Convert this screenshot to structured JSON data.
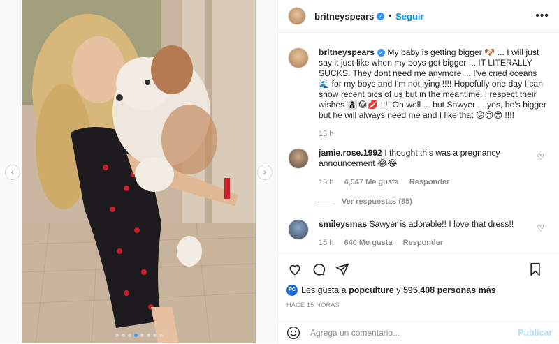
{
  "post": {
    "username": "britneyspears",
    "follow_label": "Seguir",
    "more_label": "•••",
    "caption": "My baby is getting bigger 🐶 ... I will just say it just like when my boys got bigger ... IT LITERALLY SUCKS. They dont need me anymore ... I've cried oceans 🌊 for my boys and I'm not lying !!!! Hopefully one day I can show recent pics of us but in the meantime, I respect their wishes 👩‍👦‍👦😂💋 !!!! Oh well ... but Sawyer ... yes, he's bigger but he will always need me and I like that 😜😍😎 !!!!",
    "caption_time": "15 h"
  },
  "comments": [
    {
      "username": "jamie.rose.1992",
      "text": "I thought this was a pregnancy announcement 😂😂",
      "time": "15 h",
      "likes": "4,547 Me gusta",
      "reply": "Responder",
      "replies_label": "Ver respuestas (85)"
    },
    {
      "username": "smileysmas",
      "text": "Sawyer is adorable!! I love that dress!!",
      "time": "15 h",
      "likes": "640 Me gusta",
      "reply": "Responder"
    }
  ],
  "engagement": {
    "liked_by_prefix": "Les gusta a",
    "liked_by_user": "popculture",
    "liked_by_connector": "y",
    "others": "595,408 personas más",
    "liker_avatar_text": "PC",
    "date": "HACE 15 HORAS"
  },
  "composer": {
    "placeholder": "Agrega un comentario...",
    "publish_label": "Publicar"
  },
  "carousel": {
    "dot_count": 8,
    "active_index": 3
  },
  "colors": {
    "accent": "#0095f6",
    "verified": "#3897f0",
    "muted": "#8e8e8e",
    "publish_disabled": "#b2dffc"
  }
}
